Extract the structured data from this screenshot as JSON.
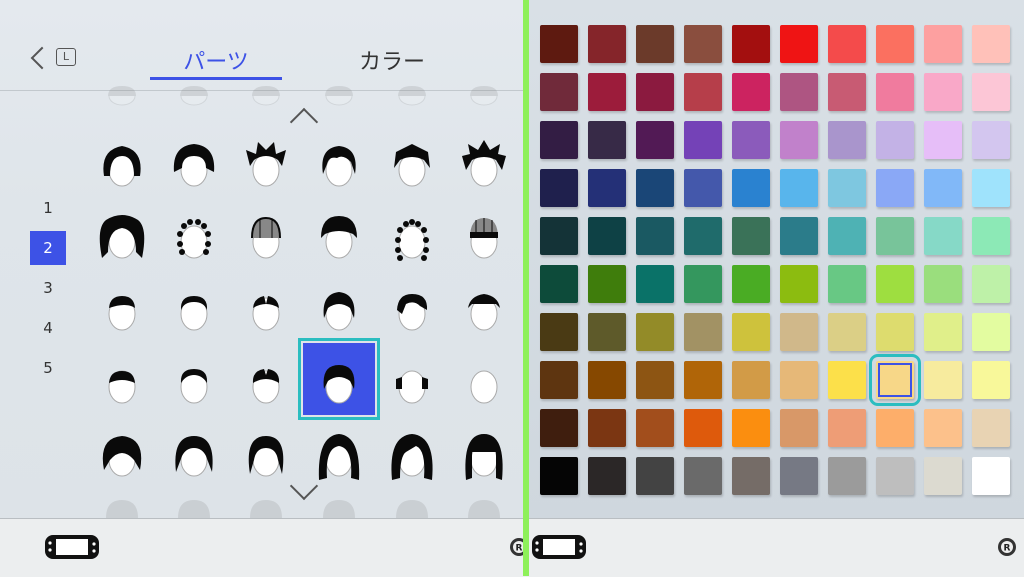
{
  "header": {
    "back_key": "L",
    "tabs": [
      {
        "label": "パーツ",
        "active": true
      },
      {
        "label": "カラー",
        "active": false
      }
    ]
  },
  "pages": {
    "items": [
      "1",
      "2",
      "3",
      "4",
      "5"
    ],
    "active": "2"
  },
  "hair_grid": {
    "selected_row": 3,
    "selected_col": 3,
    "rows": [
      [
        "medium-hair",
        "bob-hair",
        "spiky-hair",
        "medium-hair-parted",
        "spiky-hair-short",
        "spiky-hair-messy"
      ],
      [
        "long-messy-hair",
        "curly-short-hair",
        "knit-cap",
        "bowl-cut-hair",
        "curly-medium-hair",
        "beanie-hat"
      ],
      [
        "short-hair-1",
        "short-hair-2",
        "short-hair-3",
        "short-hair-4",
        "short-hair-5",
        "short-hair-6"
      ],
      [
        "short-hair-7",
        "short-hair-8",
        "short-hair-9",
        "short-hair-selected",
        "side-hair",
        "bald"
      ],
      [
        "round-hair-1",
        "round-hair-2",
        "round-hair-3",
        "long-hair-1",
        "long-hair-2",
        "long-hair-bangs"
      ]
    ]
  },
  "color_palette": {
    "selected_row": 7,
    "selected_col": 7,
    "rows": [
      [
        "#5e1a10",
        "#85252a",
        "#6b3a2a",
        "#8a4e3e",
        "#a30f0f",
        "#ef1414",
        "#f44b4b",
        "#fb7060",
        "#fda0a0",
        "#ffc1b9"
      ],
      [
        "#702a3a",
        "#9c1c3b",
        "#8b1a3f",
        "#b63e4a",
        "#cc2360",
        "#ae5582",
        "#c85b73",
        "#f07b9e",
        "#f9a8c8",
        "#fcc6d6"
      ],
      [
        "#331d44",
        "#372a47",
        "#521a55",
        "#7442b7",
        "#8b5bbb",
        "#c181cb",
        "#a995cc",
        "#c3b2e6",
        "#e6bef8",
        "#d3c6ef"
      ],
      [
        "#1f204d",
        "#243077",
        "#1a4677",
        "#4458ab",
        "#2a82d0",
        "#58b5ec",
        "#7ec7e0",
        "#8aa8f6",
        "#81b8f8",
        "#9fe3fc"
      ],
      [
        "#143337",
        "#0e4145",
        "#1a5962",
        "#1f6b6b",
        "#3a7258",
        "#2b7c8a",
        "#4eb2b4",
        "#78c49a",
        "#86d9c7",
        "#8ce9b6"
      ],
      [
        "#0d4b3a",
        "#3f7d0c",
        "#0a7268",
        "#34975e",
        "#4aac24",
        "#8cbc10",
        "#68c884",
        "#9ede40",
        "#9ade7d",
        "#bef1a8"
      ],
      [
        "#4a3a14",
        "#5e5a2a",
        "#938b28",
        "#a29264",
        "#cec23c",
        "#d0b88a",
        "#dbcf86",
        "#dddc6e",
        "#e0ef8a",
        "#e3fca0"
      ],
      [
        "#5e3510",
        "#864800",
        "#8d5513",
        "#b06508",
        "#d29b47",
        "#e6b878",
        "#fce04a",
        "#f7d788",
        "#f7eb9e",
        "#f8f89a"
      ],
      [
        "#3f1e0e",
        "#7b3612",
        "#a24e1c",
        "#de5a0c",
        "#fb8e0f",
        "#d89868",
        "#ee9d76",
        "#fdae6a",
        "#fcc18b",
        "#e8d3b3"
      ],
      [
        "#050505",
        "#2b2727",
        "#434343",
        "#6a6a6a",
        "#756c67",
        "#767984",
        "#9b9b9b",
        "#bebebe",
        "#dcdad0",
        "#ffffff"
      ]
    ]
  },
  "footer": {
    "left_icon": "console-handheld-icon",
    "right_key": "R"
  }
}
